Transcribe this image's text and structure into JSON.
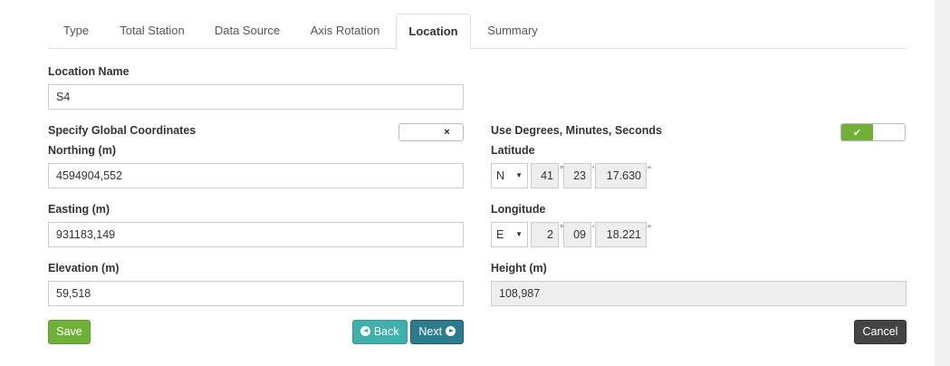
{
  "tabs": [
    {
      "label": "Type"
    },
    {
      "label": "Total Station"
    },
    {
      "label": "Data Source"
    },
    {
      "label": "Axis Rotation"
    },
    {
      "label": "Location",
      "active": true
    },
    {
      "label": "Summary"
    }
  ],
  "location_name": {
    "label": "Location Name",
    "value": "S4"
  },
  "global_coords": {
    "label": "Specify Global Coordinates",
    "toggle_symbol": "×"
  },
  "dms": {
    "label": "Use Degrees, Minutes, Seconds",
    "toggle_symbol": "✔"
  },
  "northing": {
    "label": "Northing (m)",
    "value": "4594904,552"
  },
  "easting": {
    "label": "Easting (m)",
    "value": "931183,149"
  },
  "elevation": {
    "label": "Elevation (m)",
    "value": "59,518"
  },
  "latitude": {
    "label": "Latitude",
    "hemisphere": "N",
    "degrees": "41",
    "minutes": "23",
    "seconds": "17.630"
  },
  "longitude": {
    "label": "Longitude",
    "hemisphere": "E",
    "degrees": "2",
    "minutes": "09",
    "seconds": "18.221"
  },
  "symbols": {
    "degree": "°",
    "minute": "'",
    "second": "\""
  },
  "height": {
    "label": "Height (m)",
    "value": "108,987"
  },
  "buttons": {
    "save": "Save",
    "back": "Back",
    "next": "Next",
    "cancel": "Cancel"
  },
  "colors": {
    "green": "#6fb037",
    "teal": "#3fb0ac",
    "dark_teal": "#2d7b8e",
    "dark": "#444444"
  }
}
